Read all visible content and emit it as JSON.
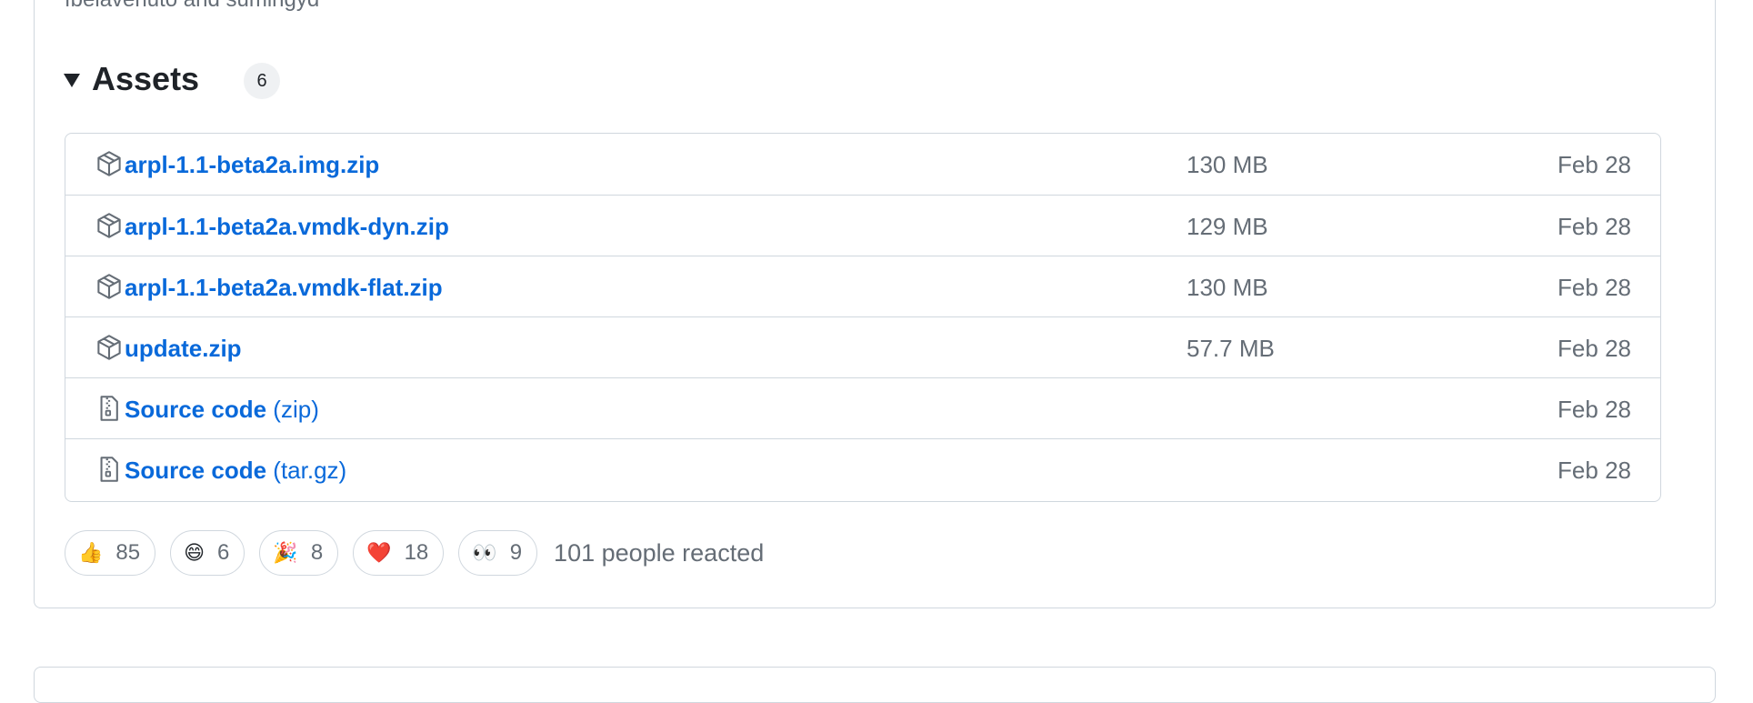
{
  "release": {
    "contributors_text": "fbelavenuto and sumingyd"
  },
  "assets": {
    "title": "Assets",
    "count": "6",
    "items": [
      {
        "name": "arpl-1.1-beta2a.img.zip",
        "suffix": "",
        "size": "130 MB",
        "date": "Feb 28",
        "icon": "package-icon"
      },
      {
        "name": "arpl-1.1-beta2a.vmdk-dyn.zip",
        "suffix": "",
        "size": "129 MB",
        "date": "Feb 28",
        "icon": "package-icon"
      },
      {
        "name": "arpl-1.1-beta2a.vmdk-flat.zip",
        "suffix": "",
        "size": "130 MB",
        "date": "Feb 28",
        "icon": "package-icon"
      },
      {
        "name": "update.zip",
        "suffix": "",
        "size": "57.7 MB",
        "date": "Feb 28",
        "icon": "package-icon"
      },
      {
        "name": "Source code",
        "suffix": "(zip)",
        "size": "",
        "date": "Feb 28",
        "icon": "file-zip-icon"
      },
      {
        "name": "Source code",
        "suffix": "(tar.gz)",
        "size": "",
        "date": "Feb 28",
        "icon": "file-zip-icon"
      }
    ]
  },
  "reactions": {
    "items": [
      {
        "emoji": "👍",
        "count": "85",
        "name": "thumbs-up"
      },
      {
        "emoji": "😄",
        "count": "6",
        "name": "laugh"
      },
      {
        "emoji": "🎉",
        "count": "8",
        "name": "hooray"
      },
      {
        "emoji": "❤️",
        "count": "18",
        "name": "heart"
      },
      {
        "emoji": "👀",
        "count": "9",
        "name": "eyes"
      }
    ],
    "summary": "101 people reacted"
  },
  "colors": {
    "link": "#0969da",
    "muted": "#656d76",
    "border": "#d0d7de"
  }
}
